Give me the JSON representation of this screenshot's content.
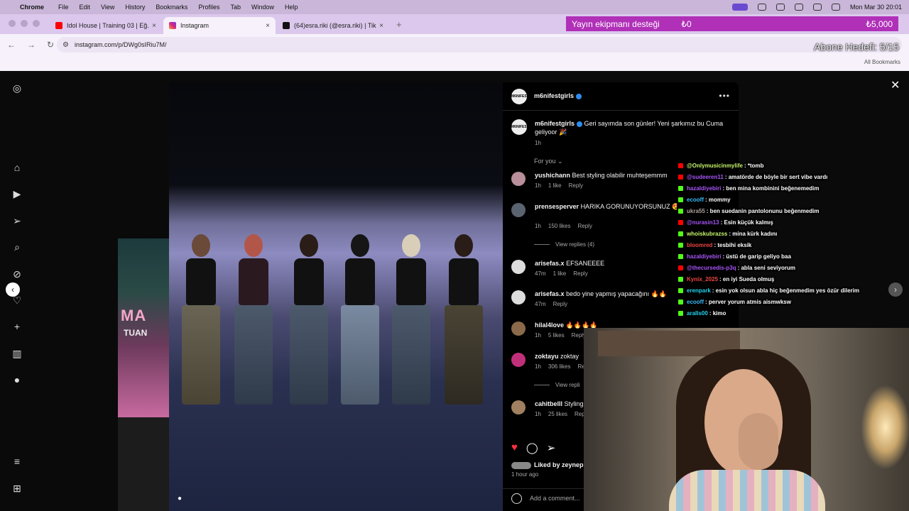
{
  "menubar": {
    "app": "Chrome",
    "items": [
      "File",
      "Edit",
      "View",
      "History",
      "Bookmarks",
      "Profiles",
      "Tab",
      "Window",
      "Help"
    ],
    "clock": "Mon Mar 30  20:01"
  },
  "tabs": [
    {
      "title": "Idol House | Training 03 | Eğ..."
    },
    {
      "title": "Instagram"
    },
    {
      "title": "(64)esra.riki (@esra.riki) | Tik..."
    }
  ],
  "toolbar": {
    "url": "instagram.com/p/DWg0sIRiu7M/",
    "all_bookmarks": "All Bookmarks"
  },
  "overlay": {
    "donation_label": "Yayın ekipmanı desteği",
    "donation_current": "₺0",
    "donation_target": "₺5,000",
    "sub_goal": "Abone Hedefi: 5/15"
  },
  "background_post": {
    "text1": "MA",
    "text2": "TUAN",
    "text3": "PER"
  },
  "post": {
    "username": "m6nifestgirls",
    "avatar_text": "M6NIFEST",
    "caption": "Geri sayımda son günler! Yeni şarkımız bu Cuma geliyoor 🎉",
    "caption_time": "1h",
    "sort_label": "For you",
    "comments": [
      {
        "user": "yushichann",
        "text": "Best styling olabilir muhteşemmm",
        "time": "1h",
        "likes": "1 like",
        "reply": "Reply"
      },
      {
        "user": "prensesperver",
        "text": "HARIKA GORUNUYORSUNUZ 😍😍",
        "time": "1h",
        "likes": "150 likes",
        "reply": "Reply"
      },
      {
        "user": "arisefas.x",
        "text": "EFSANEEEE",
        "time": "47m",
        "likes": "1 like",
        "reply": "Reply"
      },
      {
        "user": "arisefas.x",
        "text": "bedo yine yapmış yapacağını 🔥🔥",
        "time": "47m",
        "likes": "",
        "reply": "Reply"
      },
      {
        "user": "hilal4love",
        "text": "🔥🔥🔥🔥",
        "time": "1h",
        "likes": "5 likes",
        "reply": "Reply"
      },
      {
        "user": "zoktayu",
        "text": "zoktay",
        "time": "1h",
        "likes": "306 likes",
        "reply": "Reply"
      },
      {
        "user": "cahitbelll",
        "text": "Styling",
        "time": "1h",
        "likes": "25 likes",
        "reply": "Reply"
      }
    ],
    "view_replies_1": "View replies (4)",
    "view_replies_2": "View repli",
    "liked_by": "Liked by zeynep",
    "time_ago": "1 hour ago",
    "add_comment": "Add a comment..."
  },
  "chat": [
    {
      "user": "@Onlymusicinmylife",
      "msg": ": *tomb",
      "color": "#c6f46a",
      "platform": "youtube"
    },
    {
      "user": "@sudeeren11",
      "msg": ": amatörde de böyle bir sert vibe vardı",
      "color": "#a855f7",
      "platform": "youtube"
    },
    {
      "user": "hazaldiyebiri",
      "msg": ": ben mina kombinini beğenemedim",
      "color": "#a855f7",
      "platform": "kick"
    },
    {
      "user": "ecooff",
      "msg": ": mommy",
      "color": "#38bdf8",
      "platform": "kick"
    },
    {
      "user": "ukra55",
      "msg": ": ben suedanin pantolonunu beğenmedim",
      "color": "#b0a0a0",
      "platform": "kick"
    },
    {
      "user": "@nurasin13",
      "msg": ": Esin küçük kalmış",
      "color": "#a855f7",
      "platform": "youtube"
    },
    {
      "user": "whoiskubrazss",
      "msg": ": mina kürk kadını",
      "color": "#c6f46a",
      "platform": "kick"
    },
    {
      "user": "bloomred",
      "msg": ": tesbihi eksik",
      "color": "#ef4444",
      "platform": "kick"
    },
    {
      "user": "hazaldiyebiri",
      "msg": ": üstü de garip geliyo baa",
      "color": "#a855f7",
      "platform": "kick"
    },
    {
      "user": "@thecursedis-p3q",
      "msg": ": abla seni seviyorum",
      "color": "#a855f7",
      "platform": "youtube"
    },
    {
      "user": "Kynix_2025",
      "msg": ": en iyi Sueda olmuş",
      "color": "#ef4444",
      "platform": "kick"
    },
    {
      "user": "erenpark",
      "msg": ": esin yok olsun abla hiç beğenmedim yes özür dilerim",
      "color": "#22d3ee",
      "platform": "kick"
    },
    {
      "user": "ecooff",
      "msg": ": perver yorum atmis aismwksw",
      "color": "#38bdf8",
      "platform": "kick"
    },
    {
      "user": "aralls00",
      "msg": ": kimo",
      "color": "#22d3ee",
      "platform": "kick"
    }
  ]
}
